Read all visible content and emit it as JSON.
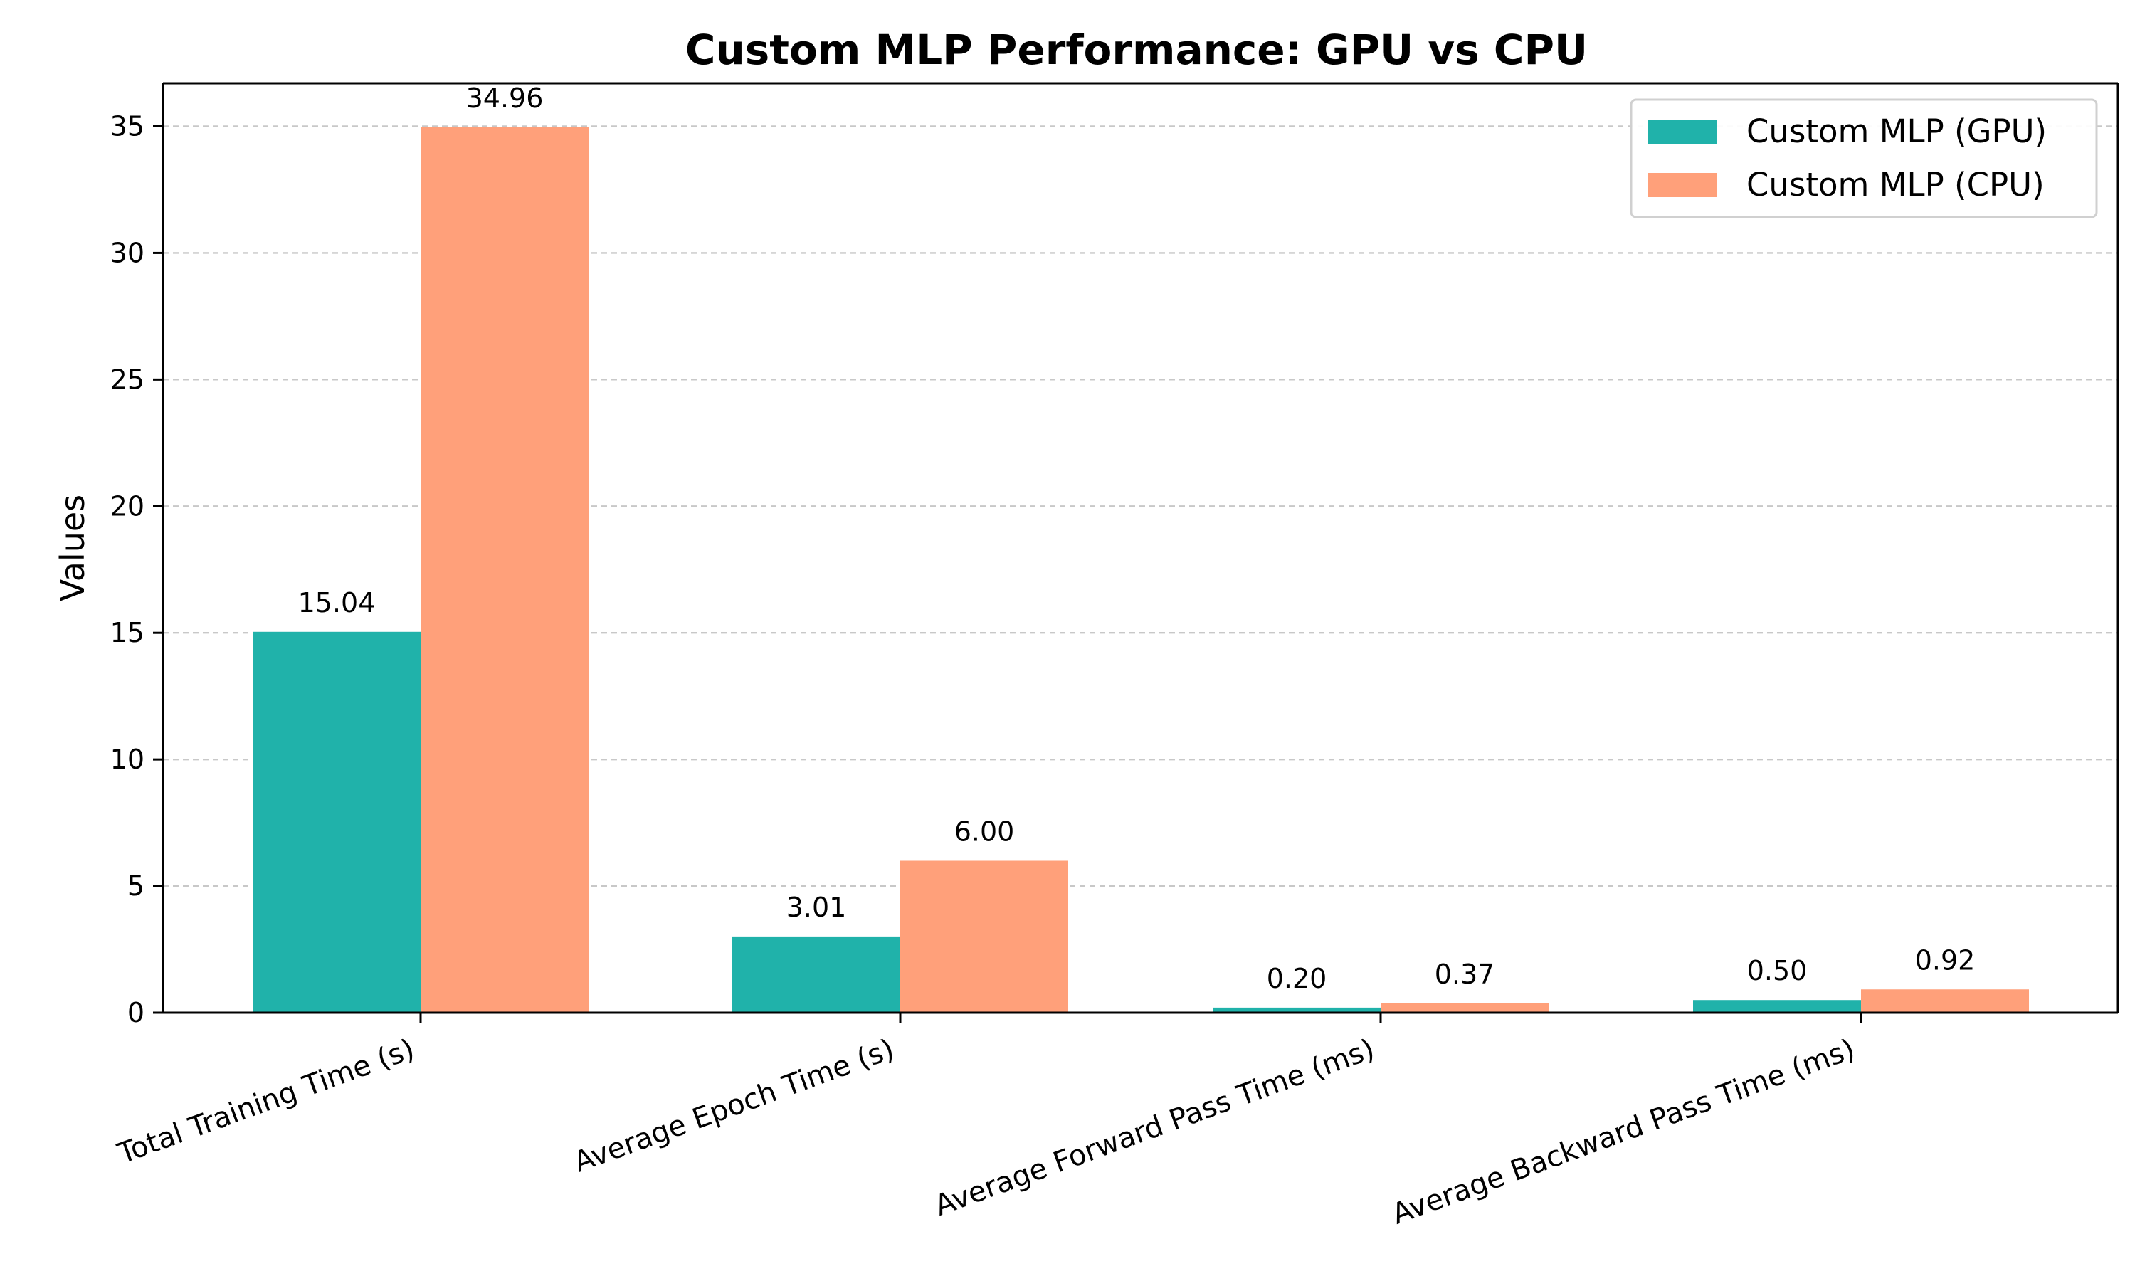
{
  "chart_data": {
    "type": "bar",
    "title": "Custom MLP Performance: GPU vs CPU",
    "xlabel": "",
    "ylabel": "Values",
    "categories": [
      "Total Training Time (s)",
      "Average Epoch Time (s)",
      "Average Forward Pass Time (ms)",
      "Average Backward Pass Time (ms)"
    ],
    "series": [
      {
        "name": "Custom MLP (GPU)",
        "values": [
          15.04,
          3.01,
          0.2,
          0.5
        ],
        "labels": [
          "15.04",
          "3.01",
          "0.20",
          "0.50"
        ],
        "color": "#20b2aa"
      },
      {
        "name": "Custom MLP (CPU)",
        "values": [
          34.96,
          6.0,
          0.37,
          0.92
        ],
        "labels": [
          "34.96",
          "6.00",
          "0.37",
          "0.92"
        ],
        "color": "#ffa07a"
      }
    ],
    "ylim": [
      0,
      36.7
    ],
    "yticks": [
      0,
      5,
      10,
      15,
      20,
      25,
      30,
      35
    ],
    "ytick_labels": [
      "0",
      "5",
      "10",
      "15",
      "20",
      "25",
      "30",
      "35"
    ],
    "grid": true,
    "grid_axis": "y",
    "legend_position": "top-right"
  }
}
